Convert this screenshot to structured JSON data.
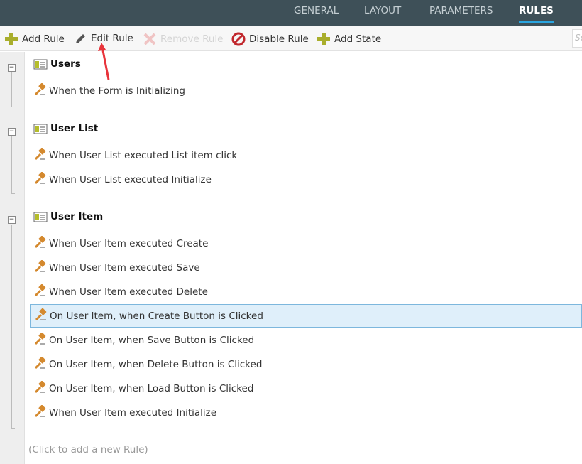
{
  "tabs": [
    {
      "label": "GENERAL"
    },
    {
      "label": "LAYOUT"
    },
    {
      "label": "PARAMETERS"
    },
    {
      "label": "RULES",
      "active": true
    }
  ],
  "toolbar": {
    "add_rule": "Add Rule",
    "edit_rule": "Edit Rule",
    "remove_rule": "Remove Rule",
    "disable_rule": "Disable Rule",
    "add_state": "Add State",
    "search_placeholder": "Se"
  },
  "groups": [
    {
      "title": "Users",
      "rules": [
        "When the Form is Initializing"
      ]
    },
    {
      "title": "User List",
      "rules": [
        "When User List executed List item click",
        "When User List executed Initialize"
      ]
    },
    {
      "title": "User Item",
      "rules": [
        "When User Item executed Create",
        "When User Item executed Save",
        "When User Item executed Delete",
        "On User Item, when Create Button is Clicked",
        "On User Item, when Save Button is Clicked",
        "On User Item, when Delete Button is Clicked",
        "On User Item, when Load Button is Clicked",
        "When User Item executed Initialize"
      ]
    }
  ],
  "selected_rule": "On User Item, when Create Button is Clicked",
  "add_new_rule": "(Click to add a new Rule)",
  "colors": {
    "header": "#3e5058",
    "accent": "#2aa5e0",
    "selected": "#dfeffa"
  }
}
